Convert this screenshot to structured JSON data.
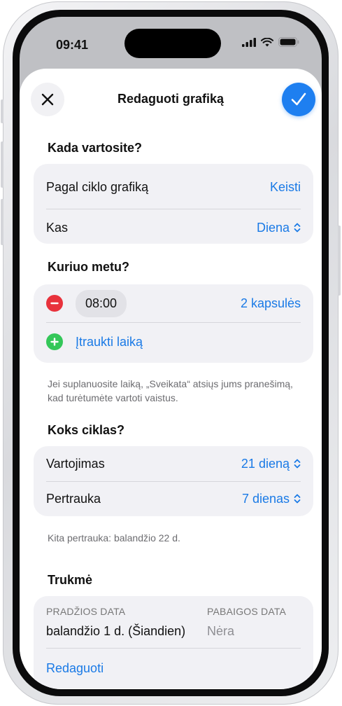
{
  "status_bar": {
    "time": "09:41"
  },
  "sheet": {
    "title": "Redaguoti grafiką"
  },
  "when": {
    "header": "Kada vartosite?",
    "rows": [
      {
        "label": "Pagal ciklo grafiką",
        "value": "Keisti"
      },
      {
        "label": "Kas",
        "value": "Diena"
      }
    ]
  },
  "what_time": {
    "header": "Kuriuo metu?",
    "time": "08:00",
    "dose": "2 kapsulės",
    "add_label": "Įtraukti laiką",
    "footnote": "Jei suplanuosite laiką, „Sveikata“ atsiųs jums pranešimą, kad turėtumėte vartoti vaistus."
  },
  "cycle": {
    "header": "Koks ciklas?",
    "rows": [
      {
        "label": "Vartojimas",
        "value": "21 dieną"
      },
      {
        "label": "Pertrauka",
        "value": "7 dienas"
      }
    ],
    "footnote": "Kita pertrauka: balandžio 22 d."
  },
  "duration": {
    "header": "Trukmė",
    "start_label": "PRADŽIOS DATA",
    "start_value": "balandžio 1 d. (Šiandien)",
    "end_label": "PABAIGOS DATA",
    "end_value": "Nėra",
    "edit_label": "Redaguoti"
  },
  "colors": {
    "accent": "#1a7ae6",
    "confirm": "#1e7ff0",
    "remove": "#e8323c",
    "add": "#34c759",
    "card": "#f1f1f5"
  }
}
